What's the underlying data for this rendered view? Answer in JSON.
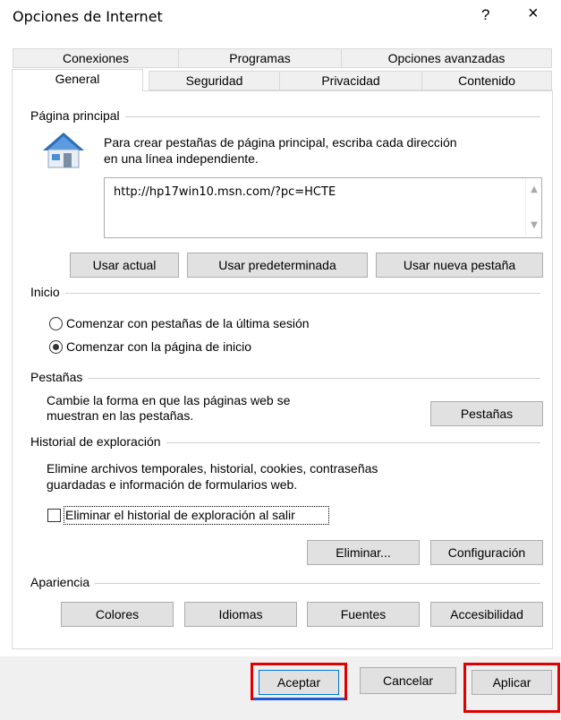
{
  "window": {
    "title": "Opciones de Internet",
    "help_label": "?",
    "close_label": "×"
  },
  "tabs": {
    "row1": [
      "Conexiones",
      "Programas",
      "Opciones avanzadas"
    ],
    "row2": [
      "General",
      "Seguridad",
      "Privacidad",
      "Contenido"
    ],
    "active": "General"
  },
  "home": {
    "section_label": "Página principal",
    "description_line1": "Para crear pestañas de página principal, escriba cada dirección",
    "description_line2": "en una línea independiente.",
    "url_value": "http://hp17win10.msn.com/?pc=HCTE",
    "buttons": [
      "Usar actual",
      "Usar predeterminada",
      "Usar nueva pestaña"
    ],
    "icon": "house-icon"
  },
  "startup": {
    "section_label": "Inicio",
    "option1": "Comenzar con pestañas de la última sesión",
    "option2": "Comenzar con la página de inicio",
    "selected": "option2"
  },
  "tabs_section": {
    "section_label": "Pestañas",
    "description_line1": "Cambie la forma en que las páginas web se",
    "description_line2": "muestran en las pestañas.",
    "button": "Pestañas"
  },
  "history": {
    "section_label": "Historial de exploración",
    "description_line1": "Elimine archivos temporales, historial, cookies, contraseñas",
    "description_line2": "guardadas e información de formularios web.",
    "checkbox_label": "Eliminar el historial de exploración al salir",
    "checkbox_checked": false,
    "delete_button": "Eliminar...",
    "settings_button": "Configuración"
  },
  "appearance": {
    "section_label": "Apariencia",
    "buttons": [
      "Colores",
      "Idiomas",
      "Fuentes",
      "Accesibilidad"
    ]
  },
  "footer": {
    "ok": "Aceptar",
    "cancel": "Cancelar",
    "apply": "Aplicar"
  },
  "colors": {
    "highlight_red": "#e00000",
    "focus_blue": "#1e5bd6",
    "house_blue": "#2d6fb8"
  }
}
